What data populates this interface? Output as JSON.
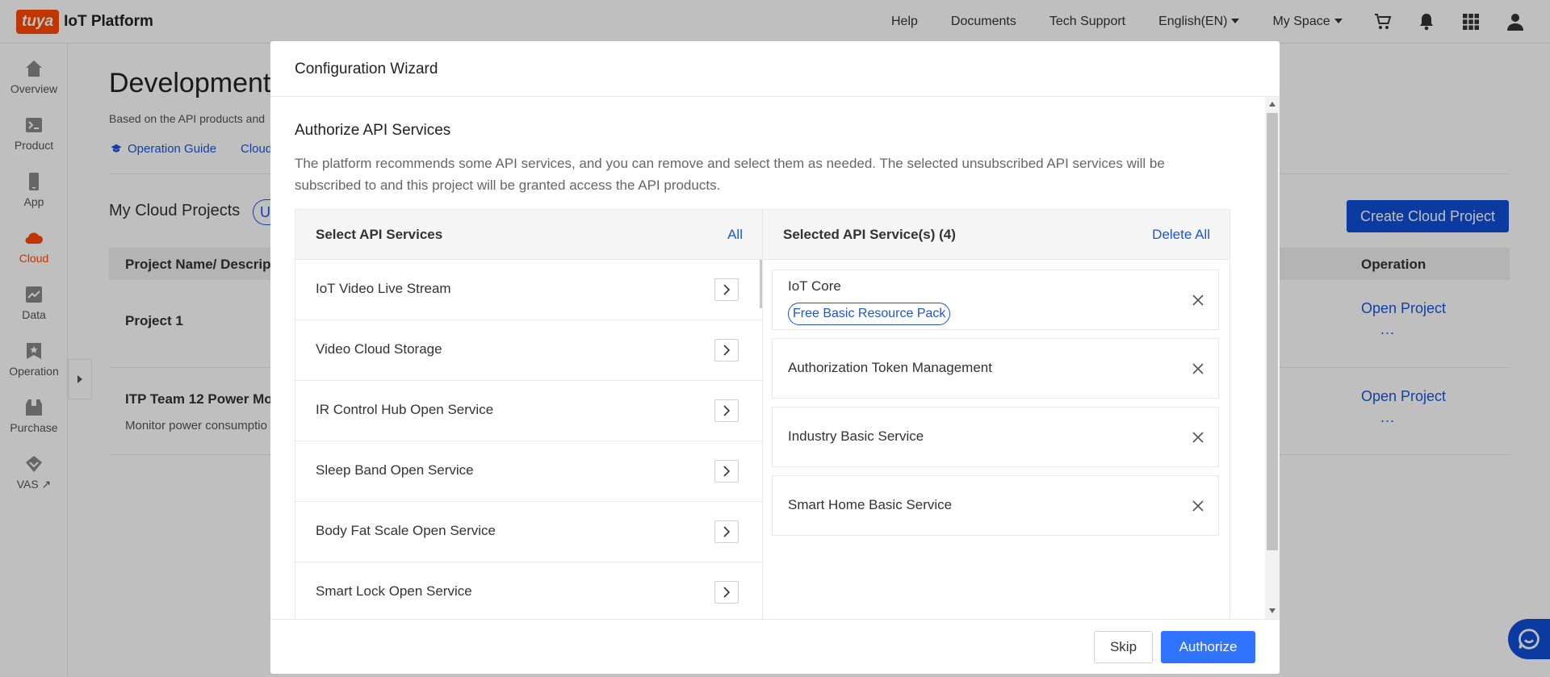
{
  "header": {
    "logo_text": "tuya",
    "platform_title": "IoT Platform",
    "nav": [
      "Help",
      "Documents",
      "Tech Support",
      "English(EN)",
      "My Space"
    ],
    "icons": [
      "cart-icon",
      "bell-icon",
      "apps-grid-icon",
      "user-icon"
    ]
  },
  "sidebar": {
    "items": [
      {
        "label": "Overview",
        "icon": "home-icon"
      },
      {
        "label": "Product",
        "icon": "terminal-icon"
      },
      {
        "label": "App",
        "icon": "phone-icon"
      },
      {
        "label": "Cloud",
        "icon": "cloud-icon",
        "active": true
      },
      {
        "label": "Data",
        "icon": "chart-icon"
      },
      {
        "label": "Operation",
        "icon": "badge-icon"
      },
      {
        "label": "Purchase",
        "icon": "box-icon"
      },
      {
        "label": "VAS ↗",
        "icon": "vas-icon"
      }
    ]
  },
  "page": {
    "title": "Development",
    "subtitle": "Based on the API products and",
    "links": [
      "Operation Guide",
      "Cloud"
    ],
    "projects_heading": "My Cloud Projects",
    "projects_pill": "U",
    "create_button": "Create Cloud Project",
    "table_head": {
      "name": "Project Name/ Descrip",
      "operation": "Operation"
    },
    "rows": [
      {
        "name": "Project 1",
        "desc": "",
        "action": "Open Project",
        "more": "..."
      },
      {
        "name": "ITP Team 12 Power Mo",
        "desc": "Monitor power consumptio",
        "action": "Open Project",
        "more": "..."
      }
    ]
  },
  "modal": {
    "title": "Configuration Wizard",
    "section_title": "Authorize API Services",
    "section_desc": "The platform recommends some API services, and you can remove and select them as needed. The selected unsubscribed API services will be subscribed to and this project will be granted access the API products.",
    "left_panel": {
      "title": "Select API Services",
      "action": "All",
      "items": [
        "IoT Video Live Stream",
        "Video Cloud Storage",
        "IR Control Hub Open Service",
        "Sleep Band Open Service",
        "Body Fat Scale Open Service",
        "Smart Lock Open Service"
      ]
    },
    "right_panel": {
      "title": "Selected API Service(s) (4)",
      "action": "Delete All",
      "items": [
        {
          "label": "IoT Core",
          "tag": "Free Basic Resource Pack"
        },
        {
          "label": "Authorization Token Management"
        },
        {
          "label": "Industry Basic Service"
        },
        {
          "label": "Smart Home Basic Service"
        }
      ]
    },
    "footer": {
      "skip": "Skip",
      "authorize": "Authorize"
    }
  },
  "colors": {
    "brand": "#ff4800",
    "link": "#1a56db",
    "primary_button": "#2f73ff",
    "create_button": "#0f4fd6"
  }
}
